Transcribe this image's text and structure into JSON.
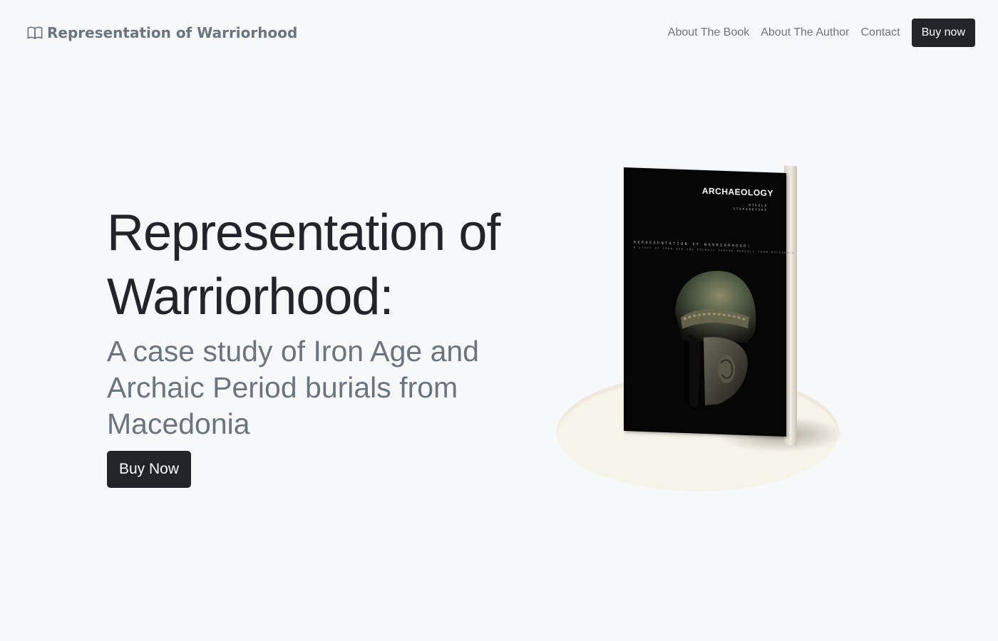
{
  "navbar": {
    "brand_label": "Representation of Warriorhood",
    "brand_icon": "book-open-icon",
    "links": [
      {
        "label": "About The Book"
      },
      {
        "label": "About The Author"
      },
      {
        "label": "Contact"
      }
    ],
    "cta_label": "Buy now"
  },
  "hero": {
    "title": "Representation of Warriorhood:",
    "subtitle": "A case study of Iron Age and Archaic Period burials from Macedonia",
    "cta_label": "Buy Now"
  },
  "book_cover": {
    "series": "ARCHAEOLOGY",
    "author": "NIKOLA STEFANOVSKI",
    "title": "REPRESENTATION OF WARRIORHOOD:",
    "subtitle": "A STUDY OF IRON AGE AND ARCHAIC PERIOD BURIALS FROM MACEDONIA"
  },
  "colors": {
    "background": "#f7f8fa",
    "dark": "#212529",
    "muted": "#6c757d",
    "platter": "#f6f3e9"
  }
}
